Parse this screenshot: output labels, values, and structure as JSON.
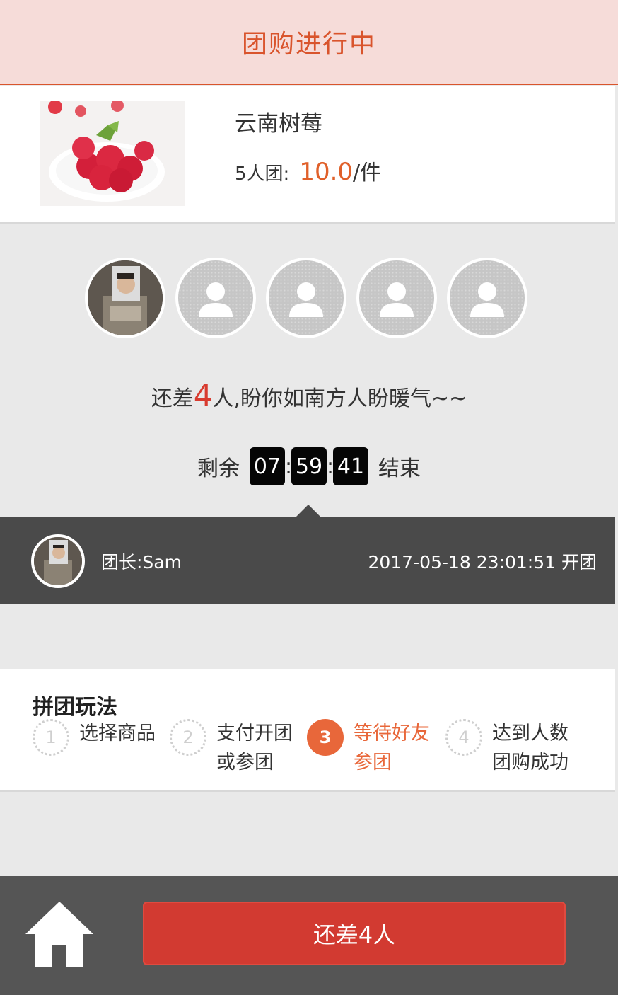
{
  "header": {
    "title": "团购进行中"
  },
  "product": {
    "name": "云南树莓",
    "group_label": "5人团:",
    "price": "10.0",
    "unit": "/件"
  },
  "status": {
    "prefix": "还差",
    "remaining": "4",
    "suffix": "人,盼你如南方人盼暖气~~"
  },
  "timer": {
    "lead": "剩余",
    "hours": "07",
    "minutes": "59",
    "seconds": "41",
    "sep": ":",
    "end": "结束"
  },
  "leader": {
    "label": "团长:Sam",
    "time": "2017-05-18 23:01:51 开团"
  },
  "rules": {
    "title": "拼团玩法",
    "steps": [
      {
        "num": "1",
        "text": "选择商品"
      },
      {
        "num": "2",
        "text": "支付开团 或参团"
      },
      {
        "num": "3",
        "text": "等待好友 参团"
      },
      {
        "num": "4",
        "text": "达到人数 团购成功"
      }
    ]
  },
  "bottom": {
    "cta_label": "还差4人"
  },
  "icons": {
    "home": "home-icon",
    "avatar_placeholder": "user-silhouette-icon"
  },
  "colors": {
    "accent": "#d9542c",
    "header_bg": "#f6dcd9",
    "price": "#e0602a",
    "cta": "#d23a31",
    "step_active": "#e8673a",
    "leader_bar": "#4a4a4a",
    "bottom_bar": "#555555"
  }
}
